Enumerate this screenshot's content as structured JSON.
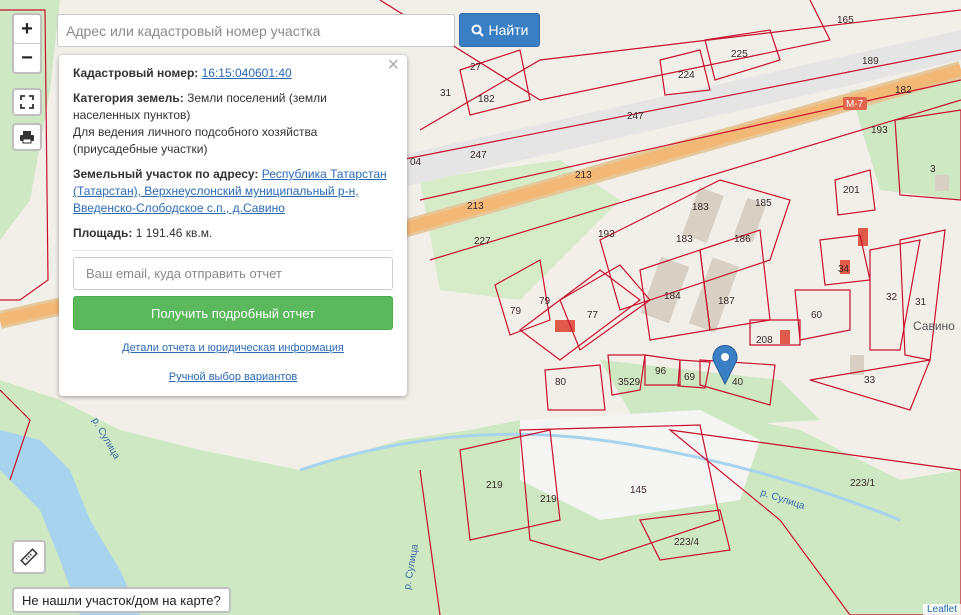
{
  "search": {
    "placeholder": "Адрес или кадастровый номер участка",
    "button_label": "Найти"
  },
  "zoom": {
    "in_label": "+",
    "out_label": "−"
  },
  "popup": {
    "cadastral_label": "Кадастровый номер:",
    "cadastral_number": "16:15:040601:40",
    "category_label": "Категория земель:",
    "category_value": "Земли поселений (земли населенных пунктов)",
    "purpose_value": "Для ведения личного подсобного хозяйства (приусадебные участки)",
    "address_label": "Земельный участок по адресу:",
    "address_value": "Республика Татарстан (Татарстан), Верхнеуслонский муниципальный р-н, Введенско-Слободское с.п., д.Савино",
    "area_label": "Площадь:",
    "area_value": "1 191.46 кв.м.",
    "email_placeholder": "Ваш email, куда отправить отчет",
    "report_button": "Получить подробный отчет",
    "details_link": "Детали отчета и юридическая информация",
    "manual_link": "Ручной выбор вариантов",
    "close_symbol": "×"
  },
  "bottom_button_label": "Не нашли участок/дом на карте?",
  "attribution": "Leaflet",
  "map": {
    "road_label": "М-7",
    "village_label": "Савино",
    "river_label_1": "р. Сулица",
    "river_label_2": "р. Сулица",
    "river_label_3": "р. Сулица",
    "parcels": [
      "165",
      "189",
      "182",
      "225",
      "224",
      "27",
      "182",
      "31",
      "247",
      "247",
      "193",
      "3",
      "213",
      "213",
      "201",
      "183",
      "185",
      "227",
      "193",
      "183",
      "186",
      "34",
      "32",
      "31",
      "79",
      "79",
      "77",
      "184",
      "187",
      "60",
      "208",
      "80",
      "3529",
      "96",
      "69",
      "40",
      "33",
      "219",
      "219",
      "145",
      "223/1",
      "223/4",
      "04"
    ]
  },
  "colors": {
    "parcel_border": "#c8102e",
    "button_blue": "#3a7fc4",
    "report_green": "#5cb85c",
    "water": "#a8d3ee",
    "green_area": "#cde8c2"
  }
}
